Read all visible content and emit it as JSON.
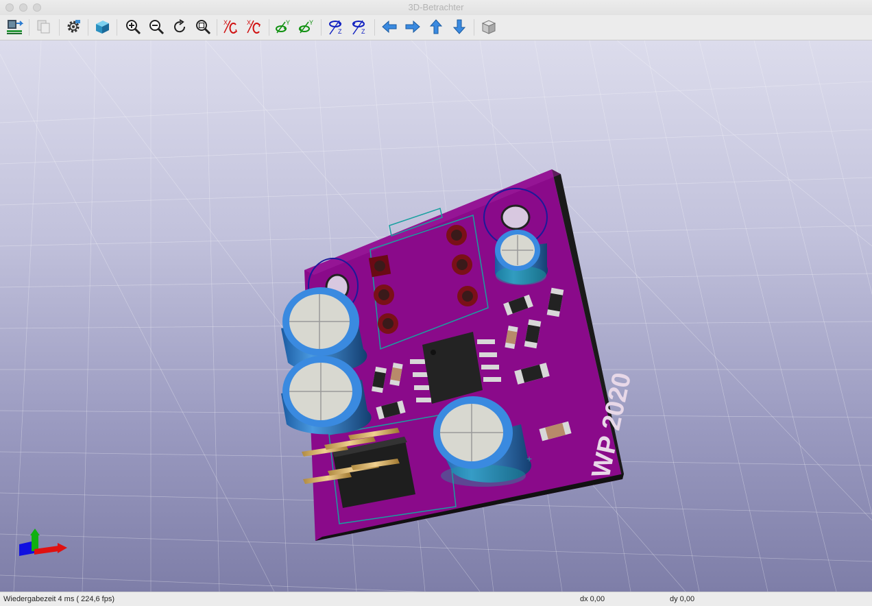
{
  "window": {
    "title": "3D-Betrachter",
    "controls": [
      "close",
      "minimize",
      "zoom"
    ]
  },
  "toolbar": {
    "buttons": [
      {
        "id": "reload-board",
        "icon": "reload-board-icon"
      },
      {
        "id": "copy-clipboard",
        "icon": "copy-icon",
        "enabled": false
      },
      {
        "id": "settings",
        "icon": "gear-icon"
      },
      {
        "id": "render-mode",
        "icon": "cube-solid-icon"
      },
      {
        "id": "zoom-in",
        "icon": "zoom-in-icon"
      },
      {
        "id": "zoom-out",
        "icon": "zoom-out-icon"
      },
      {
        "id": "redraw",
        "icon": "redraw-icon"
      },
      {
        "id": "zoom-fit",
        "icon": "zoom-fit-icon"
      },
      {
        "id": "rotate-x-cw",
        "icon": "rotate-x-cw-icon"
      },
      {
        "id": "rotate-x-ccw",
        "icon": "rotate-x-ccw-icon"
      },
      {
        "id": "rotate-y-cw",
        "icon": "rotate-y-cw-icon"
      },
      {
        "id": "rotate-y-ccw",
        "icon": "rotate-y-ccw-icon"
      },
      {
        "id": "rotate-z-cw",
        "icon": "rotate-z-cw-icon"
      },
      {
        "id": "rotate-z-ccw",
        "icon": "rotate-z-ccw-icon"
      },
      {
        "id": "pan-left",
        "icon": "arrow-left-icon"
      },
      {
        "id": "pan-right",
        "icon": "arrow-right-icon"
      },
      {
        "id": "pan-up",
        "icon": "arrow-up-icon"
      },
      {
        "id": "pan-down",
        "icon": "arrow-down-icon"
      },
      {
        "id": "orthographic",
        "icon": "cube-ortho-icon"
      }
    ]
  },
  "viewport": {
    "board_text": "WP 2020",
    "board_color": "#8a0a8a",
    "background_top": "#dcdcec",
    "background_bottom": "#7e7ea8",
    "axis_colors": {
      "x": "#e01010",
      "y": "#10b010",
      "z": "#1010e0"
    }
  },
  "status": {
    "render_time": "Wiedergabezeit 4 ms ( 224,6 fps)",
    "dx": "dx 0,00",
    "dy": "dy 0,00"
  }
}
